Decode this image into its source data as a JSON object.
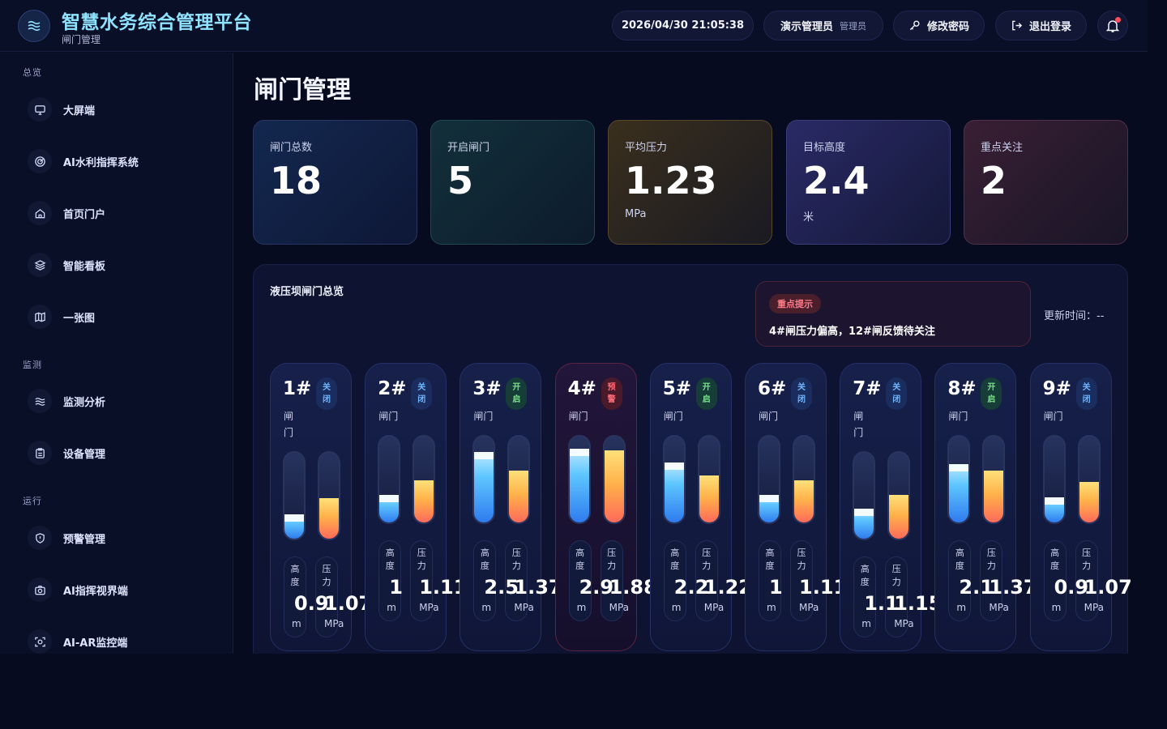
{
  "header": {
    "app_title": "智慧水务综合管理平台",
    "subtitle": "闸门管理",
    "datetime": "2026/04/30 21:05:38",
    "user_name": "演示管理员",
    "user_role": "管理员",
    "change_password": "修改密码",
    "logout": "退出登录",
    "logo_icon": "water-waves-icon",
    "bell_icon": "bell-icon"
  },
  "sidebar": {
    "groups": [
      {
        "label": "总览",
        "items": [
          {
            "label": "大屏端",
            "icon": "monitor-icon"
          },
          {
            "label": "AI水利指挥系统",
            "icon": "radar-icon"
          },
          {
            "label": "首页门户",
            "icon": "home-icon"
          },
          {
            "label": "智能看板",
            "icon": "layers-icon"
          },
          {
            "label": "一张图",
            "icon": "map-icon"
          }
        ]
      },
      {
        "label": "监测",
        "items": [
          {
            "label": "监测分析",
            "icon": "waves-icon"
          },
          {
            "label": "设备管理",
            "icon": "clipboard-icon"
          }
        ]
      },
      {
        "label": "运行",
        "items": [
          {
            "label": "预警管理",
            "icon": "shield-alert-icon"
          },
          {
            "label": "AI指挥视界端",
            "icon": "camera-icon"
          },
          {
            "label": "AI-AR监控端",
            "icon": "scan-icon"
          }
        ]
      }
    ]
  },
  "main": {
    "page_title": "闸门管理",
    "stats": [
      {
        "label": "闸门总数",
        "value": "18",
        "unit": ""
      },
      {
        "label": "开启闸门",
        "value": "5",
        "unit": ""
      },
      {
        "label": "平均压力",
        "value": "1.23",
        "unit": "MPa"
      },
      {
        "label": "目标高度",
        "value": "2.4",
        "unit": "米"
      },
      {
        "label": "重点关注",
        "value": "2",
        "unit": ""
      }
    ],
    "panel": {
      "title": "液压坝闸门总览",
      "alert_tag": "重点提示",
      "alert_text": "4#闸压力偏高，12#闸反馈待关注",
      "update_time": "更新时间：--"
    },
    "gate_caption": "闸门",
    "height_label": "高度",
    "pressure_label": "压力",
    "height_unit": "m",
    "pressure_unit": "MPa",
    "gates": [
      {
        "name": "1#",
        "status": "关闭",
        "state": "closed",
        "height": "0.9",
        "pressure": "1.07",
        "height_level": 0.28,
        "pressure_level": 0.47
      },
      {
        "name": "2#",
        "status": "关闭",
        "state": "closed",
        "height": "1",
        "pressure": "1.11",
        "height_level": 0.32,
        "pressure_level": 0.49
      },
      {
        "name": "3#",
        "status": "开启",
        "state": "open",
        "height": "2.5",
        "pressure": "1.37",
        "height_level": 0.82,
        "pressure_level": 0.6
      },
      {
        "name": "4#",
        "status": "预警",
        "state": "alarm",
        "height": "2.9",
        "pressure": "1.88",
        "height_level": 0.86,
        "pressure_level": 0.84
      },
      {
        "name": "5#",
        "status": "开启",
        "state": "open",
        "height": "2.2",
        "pressure": "1.22",
        "height_level": 0.7,
        "pressure_level": 0.55
      },
      {
        "name": "6#",
        "status": "关闭",
        "state": "closed",
        "height": "1",
        "pressure": "1.11",
        "height_level": 0.32,
        "pressure_level": 0.49
      },
      {
        "name": "7#",
        "status": "关闭",
        "state": "closed",
        "height": "1.1",
        "pressure": "1.15",
        "height_level": 0.35,
        "pressure_level": 0.51
      },
      {
        "name": "8#",
        "status": "开启",
        "state": "open",
        "height": "2.1",
        "pressure": "1.37",
        "height_level": 0.68,
        "pressure_level": 0.6
      },
      {
        "name": "9#",
        "status": "关闭",
        "state": "closed",
        "height": "0.9",
        "pressure": "1.07",
        "height_level": 0.29,
        "pressure_level": 0.47
      }
    ]
  },
  "colors": {
    "accent_title": "#8fe3ff",
    "closed": "#6fb6ff",
    "open": "#7be38a",
    "alarm": "#ff6b78"
  }
}
